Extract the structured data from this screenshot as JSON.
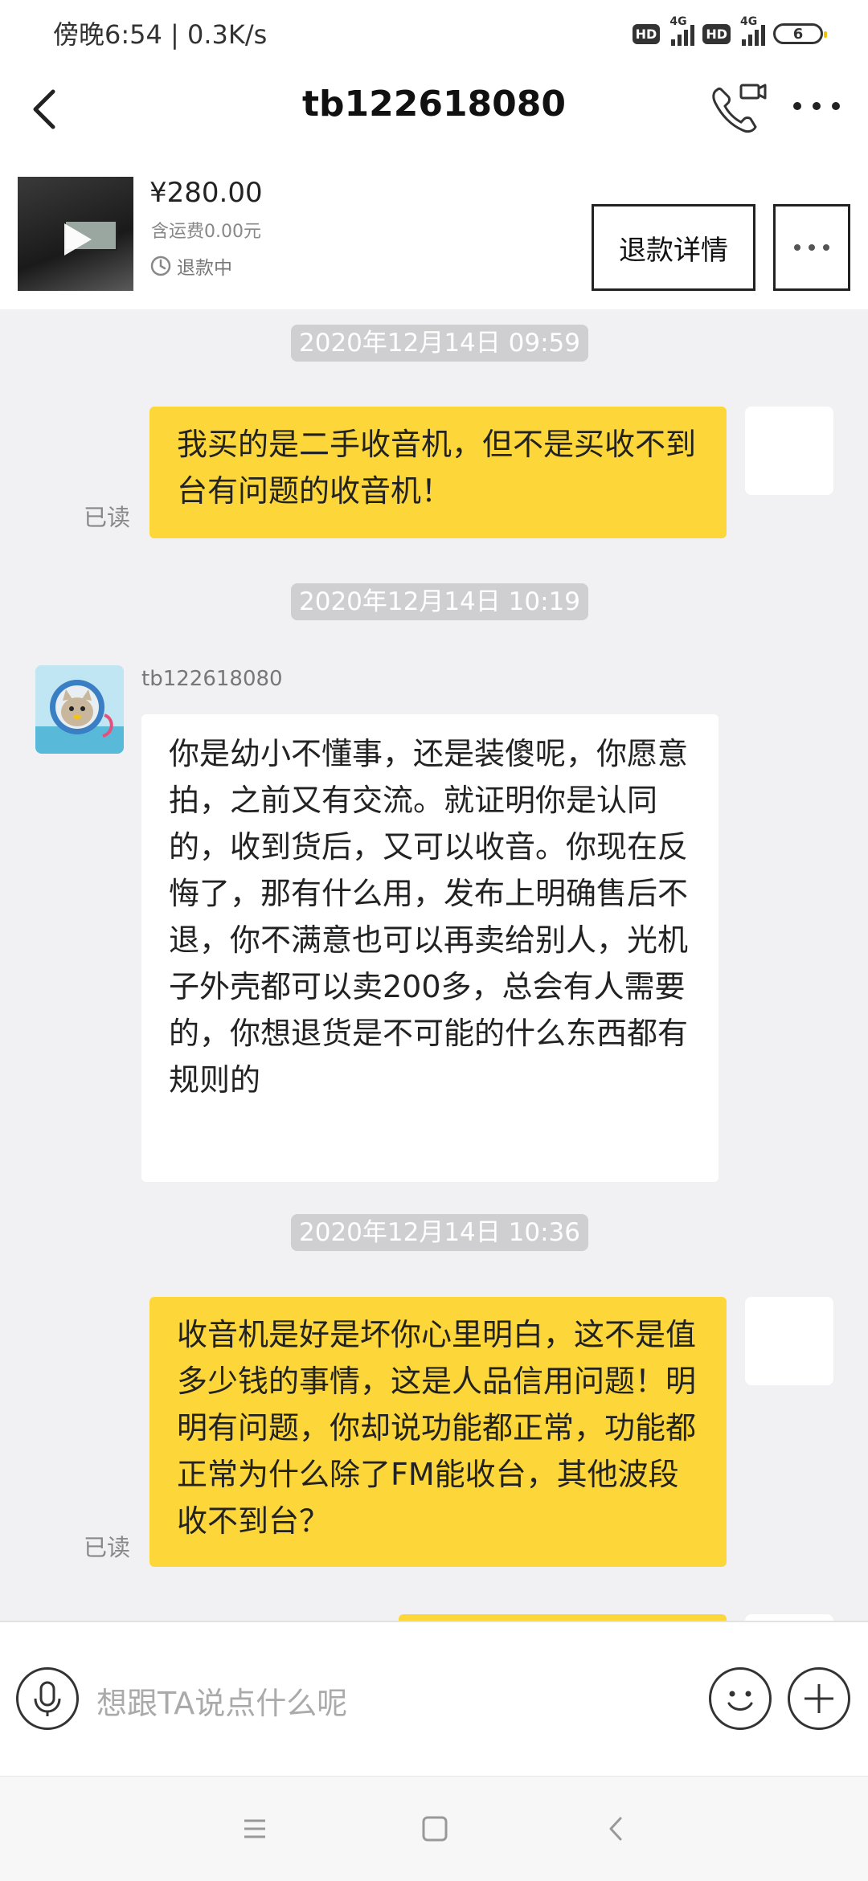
{
  "status_bar": {
    "time": "傍晚6:54 | 0.3K/s",
    "hd_1": "HD",
    "net_1": "4G",
    "hd_2": "HD",
    "net_2": "4G",
    "battery": "6"
  },
  "header": {
    "title": "tb122618080",
    "icons": [
      "back-arrow-icon",
      "video-call-icon",
      "more-icon"
    ]
  },
  "order": {
    "price": "¥280.00",
    "shipping": "含运费0.00元",
    "status": "退款中",
    "refund_button": "退款详情"
  },
  "messages": [
    {
      "type": "timestamp",
      "text": "2020年12月14日 09:59"
    },
    {
      "type": "me",
      "text": "我买的是二手收音机，但不是买收不到台有问题的收音机！",
      "read": "已读"
    },
    {
      "type": "timestamp",
      "text": "2020年12月14日 10:19"
    },
    {
      "type": "other",
      "sender": "tb122618080",
      "text": "你是幼小不懂事，还是装傻呢，你愿意拍，之前又有交流。就证明你是认同的，收到货后，又可以收音。你现在反悔了，那有什么用，发布上明确售后不退，你不满意也可以再卖给别人，光机子外壳都可以卖200多，总会有人需要的，你想退货是不可能的什么东西都有规则的"
    },
    {
      "type": "timestamp",
      "text": "2020年12月14日 10:36"
    },
    {
      "type": "me",
      "text": "收音机是好是坏你心里明白，这不是值多少钱的事情，这是人品信用问题！明明有问题，你却说功能都正常，功能都正常为什么除了FM能收台，其他波段收不到台？",
      "read": "已读"
    }
  ],
  "input": {
    "placeholder": "想跟TA说点什么呢"
  },
  "colors": {
    "my_bubble": "#fdd73a",
    "chat_bg": "#f1f1f3",
    "timestamp_bg": "#cfcfd1"
  }
}
